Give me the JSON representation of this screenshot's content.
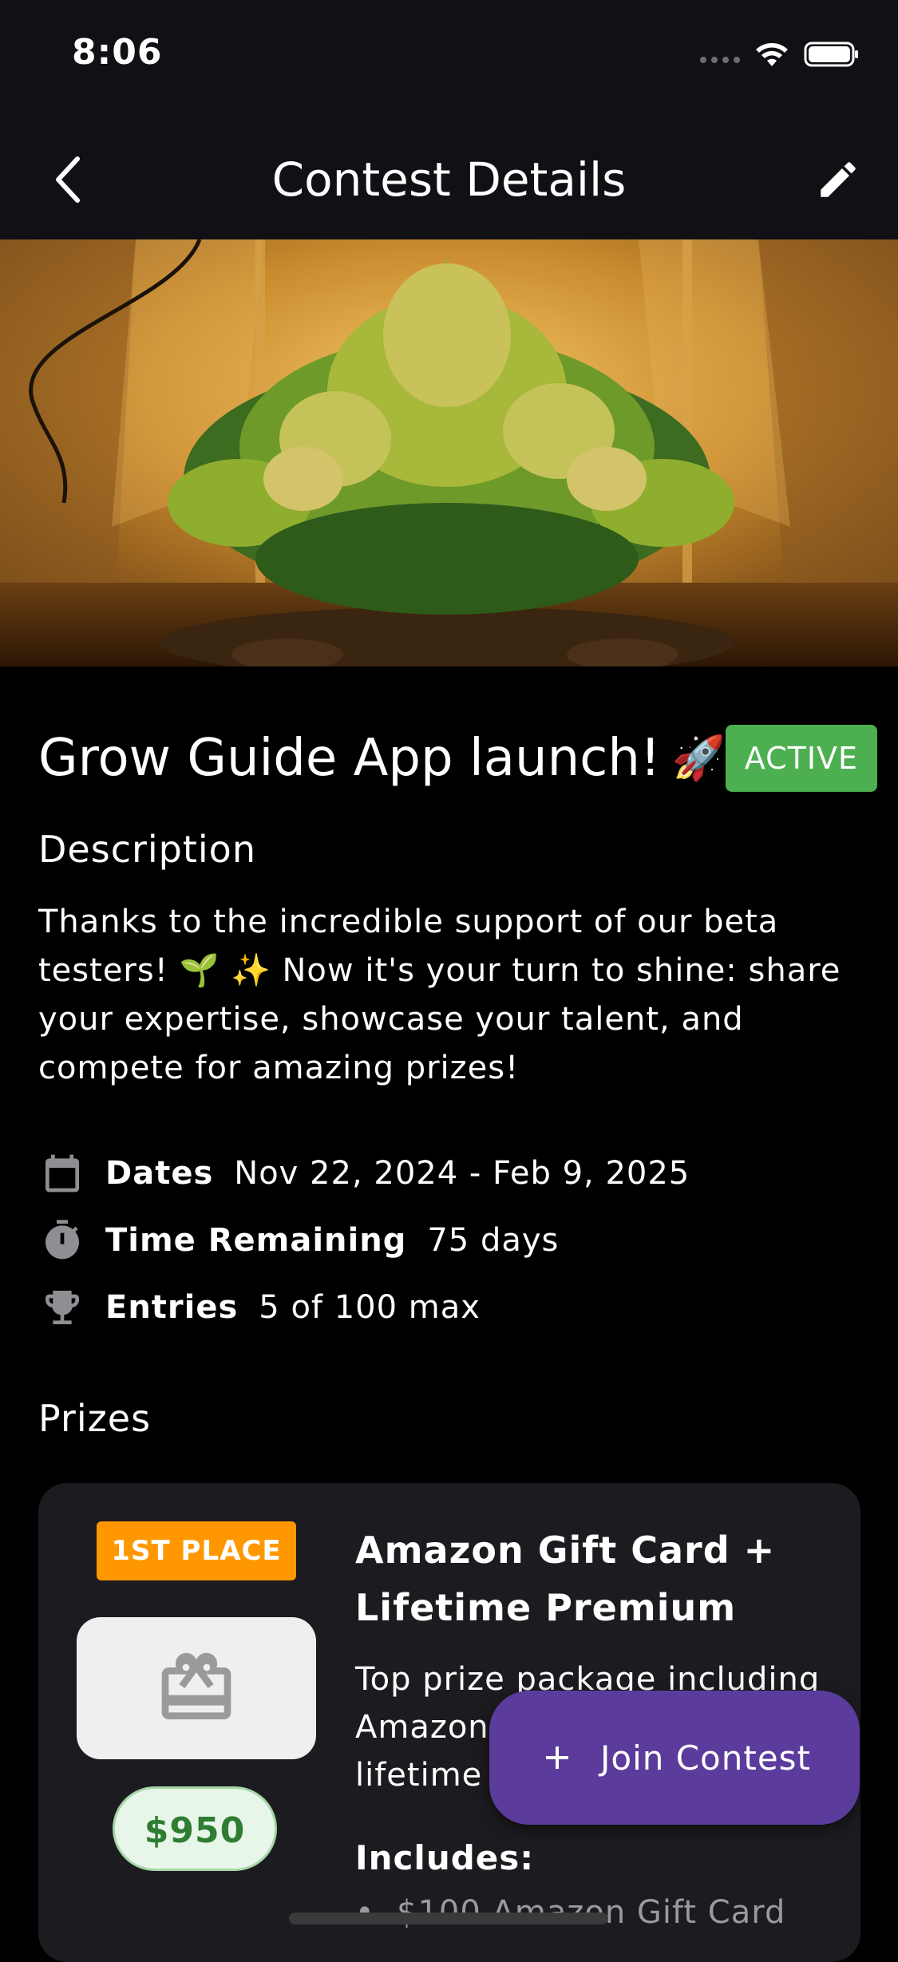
{
  "status_bar": {
    "time": "8:06"
  },
  "nav": {
    "title": "Contest Details",
    "back_icon": "chevron-left-icon",
    "edit_icon": "pencil-icon"
  },
  "contest": {
    "title": "Grow Guide App launch!",
    "title_emoji": "🚀",
    "status": "ACTIVE",
    "status_color": "#4caf50"
  },
  "description": {
    "heading": "Description",
    "text": "Thanks to the incredible support of our beta testers! 🌱 ✨  Now it's your turn to shine: share your expertise, showcase your talent, and compete for amazing prizes!"
  },
  "info": {
    "dates_label": "Dates",
    "dates_value": "Nov 22, 2024 - Feb 9, 2025",
    "remaining_label": "Time Remaining",
    "remaining_value": "75 days",
    "entries_label": "Entries",
    "entries_value": "5 of 100 max"
  },
  "prizes": {
    "heading": "Prizes",
    "items": [
      {
        "place": "1ST PLACE",
        "place_color": "#ff9800",
        "value": "$950",
        "name": "Amazon Gift Card + Lifetime Premium",
        "description": "Top prize package including Amazon gift card and lifetime access",
        "includes_label": "Includes:",
        "includes": [
          "$100 Amazon Gift Card"
        ]
      }
    ]
  },
  "fab": {
    "label": "Join Contest",
    "icon": "plus-icon",
    "color": "#5b3c9c"
  }
}
